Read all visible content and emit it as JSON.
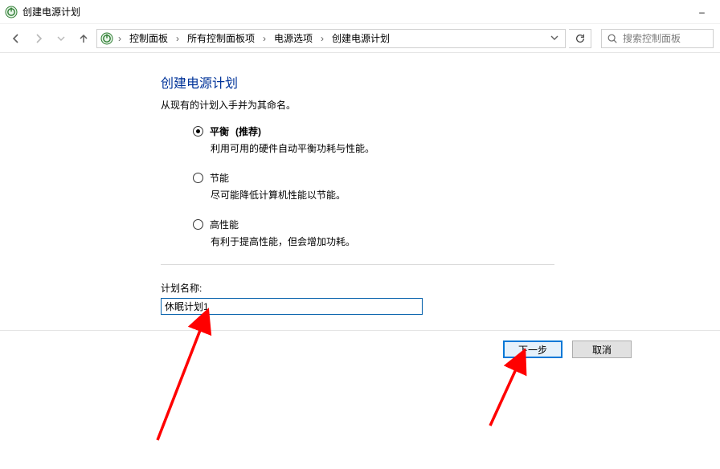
{
  "window": {
    "title": "创建电源计划",
    "minimize": "–"
  },
  "breadcrumbs": {
    "items": [
      "控制面板",
      "所有控制面板项",
      "电源选项",
      "创建电源计划"
    ]
  },
  "search": {
    "placeholder": "搜索控制面板"
  },
  "page": {
    "heading": "创建电源计划",
    "subheading": "从现有的计划入手并为其命名。",
    "plans": [
      {
        "name": "平衡",
        "recommend": "(推荐)",
        "desc": "利用可用的硬件自动平衡功耗与性能。",
        "checked": true
      },
      {
        "name": "节能",
        "recommend": "",
        "desc": "尽可能降低计算机性能以节能。",
        "checked": false
      },
      {
        "name": "高性能",
        "recommend": "",
        "desc": "有利于提高性能，但会增加功耗。",
        "checked": false
      }
    ],
    "plan_name_label": "计划名称:",
    "plan_name_value": "休眠计划1"
  },
  "footer": {
    "next": "下一步",
    "cancel": "取消"
  }
}
